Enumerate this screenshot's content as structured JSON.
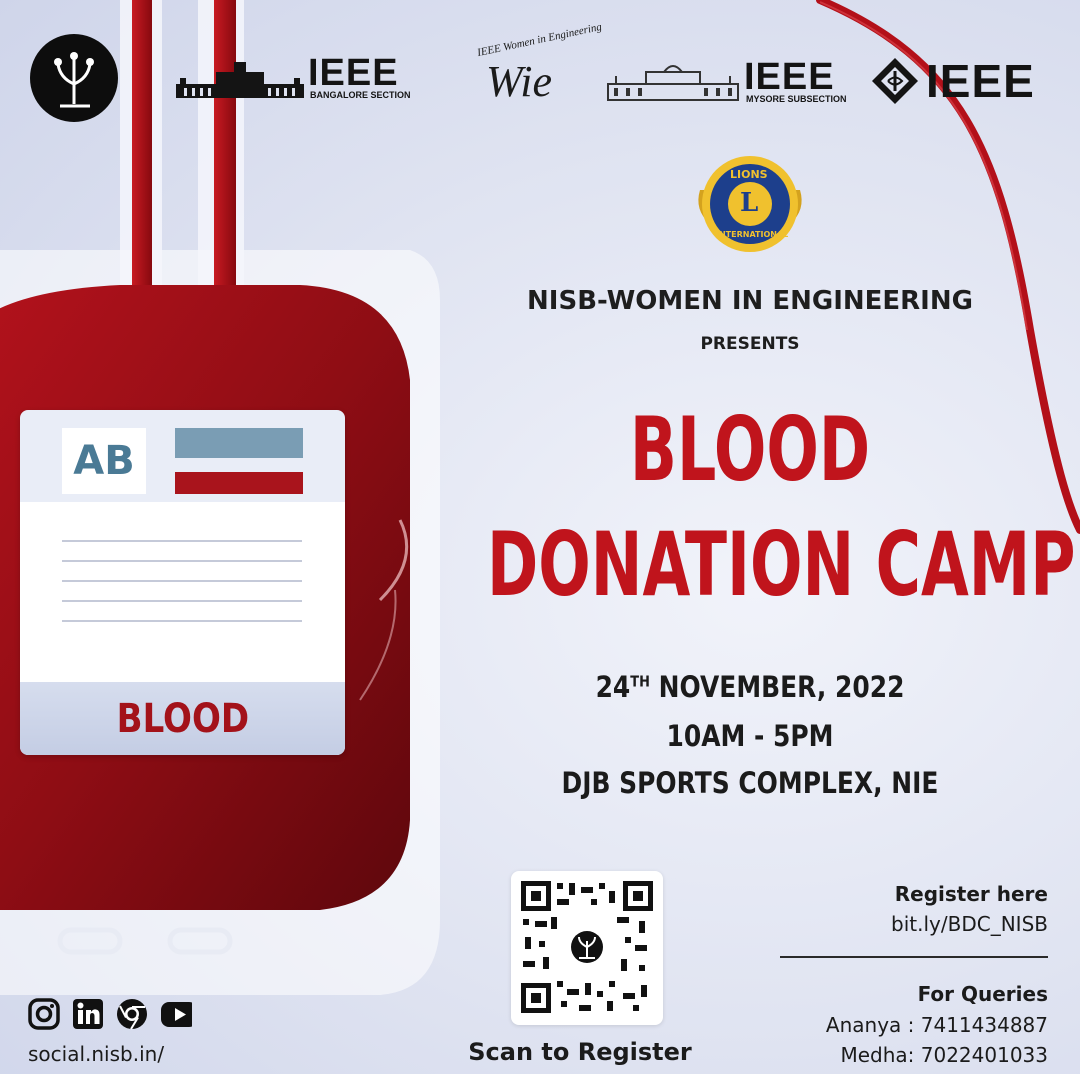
{
  "logos": {
    "ieee_bangalore": {
      "name": "IEEE",
      "subtitle": "BANGALORE SECTION"
    },
    "wie": {
      "arc_text": "IEEE Women in Engineering",
      "mark": "Wie"
    },
    "ieee_mysore": {
      "name": "IEEE",
      "subtitle": "MYSORE SUBSECTION"
    },
    "ieee_main": {
      "name": "IEEE"
    },
    "lions": {
      "top": "LIONS",
      "center": "L",
      "bottom": "INTERNATIONAL"
    }
  },
  "presenter": "NISB-WOMEN IN ENGINEERING",
  "presents": "PRESENTS",
  "title_line1": "BLOOD",
  "title_line2": "DONATION CAMP",
  "event": {
    "date_day": "24",
    "date_sup": "TH",
    "date_rest": " NOVEMBER, 2022",
    "time": "10AM - 5PM",
    "venue": "DJB SPORTS COMPLEX, NIE"
  },
  "bag": {
    "blood_type": "AB",
    "label": "BLOOD"
  },
  "register": {
    "heading": "Register here",
    "link": "bit.ly/BDC_NISB"
  },
  "queries": {
    "heading": "For Queries",
    "contacts": [
      "Ananya : 7411434887",
      "Medha: 7022401033"
    ]
  },
  "qr": {
    "caption": "Scan to Register"
  },
  "social": {
    "icons": [
      "instagram-icon",
      "linkedin-icon",
      "chrome-icon",
      "youtube-icon"
    ],
    "link": "social.nisb.in/"
  },
  "colors": {
    "accent_red": "#c0141c",
    "blood": "#8e0d14",
    "text_dark": "#1b1b1b"
  }
}
